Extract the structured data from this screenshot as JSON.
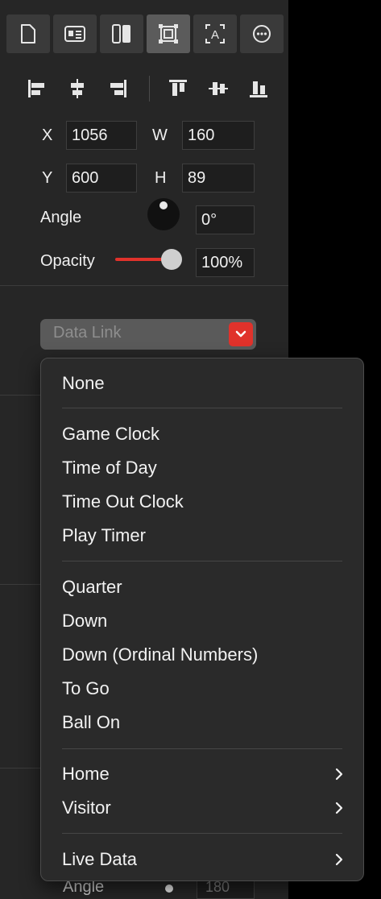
{
  "toolbar": {
    "tabs": [
      {
        "icon": "document-icon"
      },
      {
        "icon": "id-card-icon"
      },
      {
        "icon": "columns-icon"
      },
      {
        "icon": "frame-icon",
        "active": true
      },
      {
        "icon": "text-frame-icon",
        "glyph": "A"
      },
      {
        "icon": "more-icon"
      }
    ]
  },
  "align": {
    "buttons": [
      "align-left-icon",
      "align-center-h-icon",
      "align-right-icon",
      "align-top-icon",
      "align-middle-v-icon",
      "align-bottom-icon"
    ]
  },
  "geometry": {
    "x_label": "X",
    "x_value": "1056",
    "w_label": "W",
    "w_value": "160",
    "y_label": "Y",
    "y_value": "600",
    "h_label": "H",
    "h_value": "89",
    "angle_label": "Angle",
    "angle_value": "0°",
    "opacity_label": "Opacity",
    "opacity_value": "100%",
    "opacity_level": 1.0
  },
  "data_link": {
    "placeholder": "Data Link"
  },
  "menu": {
    "none": "None",
    "group1": [
      "Game Clock",
      "Time of Day",
      "Time Out Clock",
      "Play Timer"
    ],
    "group2": [
      "Quarter",
      "Down",
      "Down (Ordinal Numbers)",
      "To Go",
      "Ball On"
    ],
    "group3": [
      "Home",
      "Visitor"
    ],
    "live_data": "Live Data"
  },
  "under": {
    "angle_label": "Angle",
    "value": "180"
  },
  "colors": {
    "accent": "#e0322b",
    "panel": "#262626",
    "menu": "#2a2a2a"
  }
}
